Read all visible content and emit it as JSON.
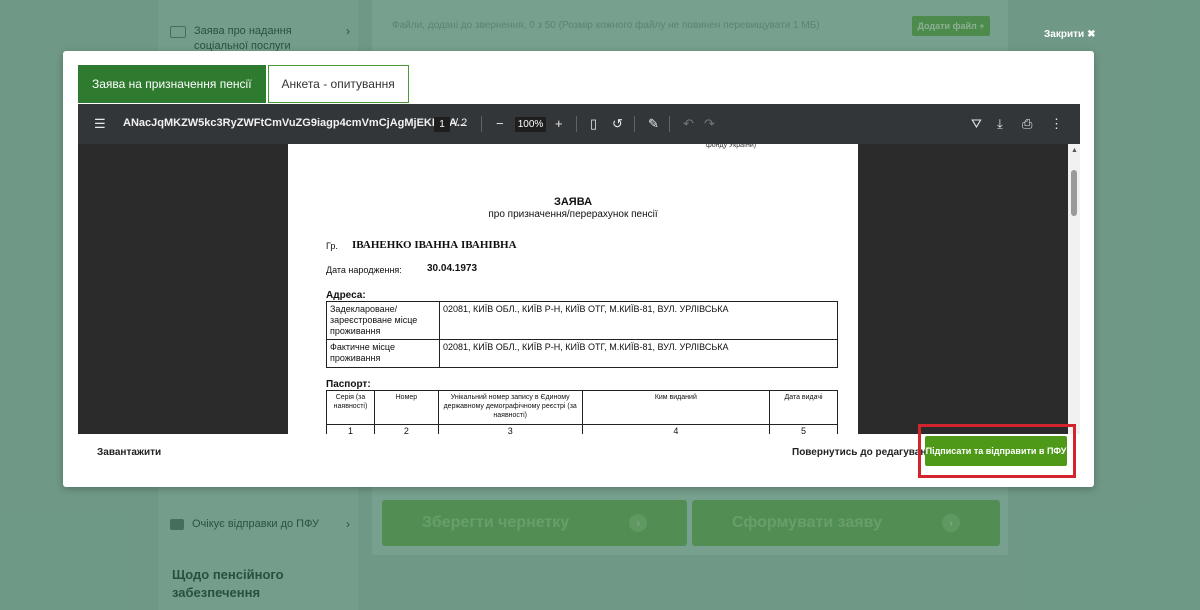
{
  "background": {
    "nav_items": [
      {
        "label": "Заява про надання соціальної послуги"
      },
      {
        "label": "Очікує відправки до ПФУ"
      }
    ],
    "section_title": "Щодо пенсійного забезпечення",
    "files_hint": "Файли, додані до звернення, 0 з 50 (Розмір кожного файлу не повинен перевищувати 1 МБ)",
    "add_file_label": "Додати файл +",
    "save_draft_label": "Зберегти чернетку",
    "form_application_label": "Сформувати заяву"
  },
  "modal": {
    "close_label": "Закрити",
    "tabs": [
      {
        "label": "Заява на призначення пенсії",
        "active": true
      },
      {
        "label": "Анкета - опитування",
        "active": false
      }
    ],
    "viewer": {
      "filename": "ANacJqMKZW5kc3RyZWFtCmVuZG9iagp4cmVmCjAgMjEKMDA...",
      "current_page": "1",
      "total_pages": "/ 2",
      "zoom": "100%"
    },
    "document": {
      "top_note": "фонду України)",
      "title": "ЗАЯВА",
      "subtitle": "про призначення/перерахунок пенсії",
      "name_prefix": "Гр.",
      "name": "ІВАНЕНКО ІВАННА ІВАНІВНА",
      "dob_label": "Дата народження:",
      "dob": "30.04.1973",
      "address_heading": "Адреса:",
      "address_rows": [
        {
          "label": "Задекларoване/ зареєстроване місце проживання",
          "value": "02081, КИЇВ ОБЛ., КИЇВ Р-Н, КИЇВ ОТГ, М.КИЇВ-81, ВУЛ. УРЛІВСЬКА"
        },
        {
          "label": "Фактичне місце проживання",
          "value": "02081, КИЇВ ОБЛ., КИЇВ Р-Н, КИЇВ ОТГ, М.КИЇВ-81, ВУЛ. УРЛІВСЬКА"
        }
      ],
      "passport_heading": "Паспорт:",
      "passport_columns": [
        "Серія (за наявності)",
        "Номер",
        "Унікальний номер запису в Єдиному державному демографічному реєстрі (за наявності)",
        "Ким виданий",
        "Дата видачі"
      ],
      "passport_numbers": [
        "1",
        "2",
        "3",
        "4",
        "5"
      ]
    },
    "footer": {
      "download_label": "Завантажити",
      "back_label": "Повернутись до редагування",
      "sign_label": "Підписати та відправити в ПФУ"
    }
  },
  "colors": {
    "tab_active": "#2e7a2e",
    "sign_button": "#4e9a18",
    "highlight": "#d3232c",
    "pdf_toolbar": "#323639"
  }
}
